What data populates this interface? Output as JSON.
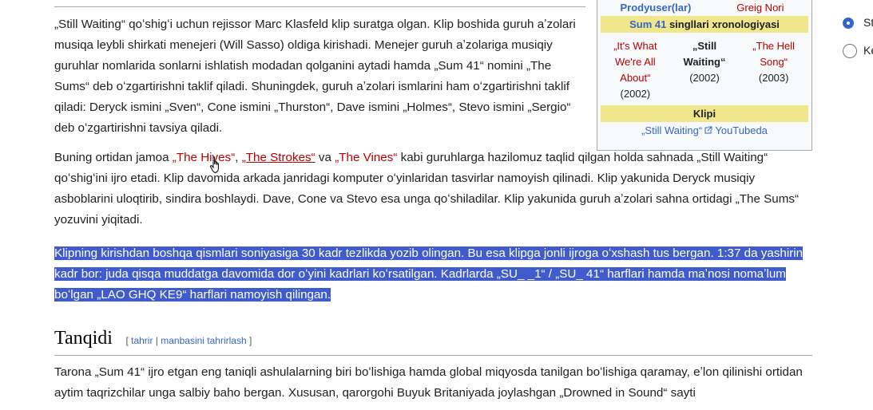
{
  "infobox": {
    "producer_label": "Prodyuser(lar)",
    "producer_value": "Greig Nori",
    "chronology_artist": "Sum 41",
    "chronology_label": " singllari xronologiyasi",
    "prev_title": "„It's What We're All About“",
    "prev_year": "(2002)",
    "current_title": "„Still Waiting“",
    "current_year": "(2002)",
    "next_title": "„The Hell Song“",
    "next_year": "(2003)",
    "video_header": "Klipi",
    "video_link": "„Still Waiting“",
    "video_site": "YouTubeda"
  },
  "para1": "„Still Waiting“ qoʻshigʻi uchun rejissor Marc Klasfeld klip suratga olgan. Klip boshida guruh aʼzolari musiqa leybli shirkati menejeri (Will Sasso) oldiga kirishadi. Menejer guruh aʼzolariga musiqiy guruhlar nomlarida sonlarni ishlatish modadan qolganini aytadi hamda „Sum 41“ nomini „The Sums“ deb oʻzgartirishni taklif qiladi. Shuningdek, guruh aʼzolari ismlarini ham oʻzgartirishni taklif qiladi: Deryck ismini „Sven“, Cone ismini „Thurston“, Dave ismini „Holmes“, Stevo ismini „Sergio“ deb oʻzgartirishni tavsiya qiladi.",
  "para2": {
    "lead": "Buning ortidan jamoa ",
    "link1": "„The Hives“",
    "sep1": ", ",
    "link2": "„The Strokes“",
    "sep2": " va ",
    "link3": "„The Vines“",
    "rest": " kabi guruhlarga hazilomuz taqlid qilgan holda sahnada „Still Waiting“ qoʻshigʻini ijro etadi. Klip davomida arkada janridagi komputer oʻyinlaridan tasvirlar namoyish qilinadi. Klip yakunida Deryck musiqiy asboblarini uloqtirib, sindira boshlaydi. Dave, Cone va Stevo esa unga qoʻshiladilar. Klip yakunida guruh aʼzolari sahna ortidagi „The Sums“ yozuvini yiqitadi."
  },
  "para3": "Klipning kirishdan boshqa qismlari soniyasiga 30 kadr tezlikda yozib olingan. Bu esa klipga jonli ijroga oʻxshash tus bergan. 1:37 da yashirin kadr bor: juda qisqa muddatga davomida dor oʻyini kadrlari koʻrsatilgan. Kadrlarda „SU_ _1“ / „SU_ 41“ harflari hamda maʼnosi nomaʼlum boʻlgan „LAO GHQ KE9“ harflari namoyish qilingan.",
  "section": {
    "title": "Tanqidi",
    "bracket_open": "[ ",
    "edit": "tahrir",
    "divider": " | ",
    "edit_source": "manbasini tahrirlash",
    "bracket_close": " ]"
  },
  "para4": "Tarona „Sum 41“ ijro etgan eng taniqli ashulalarning biri boʻlishiga hamda global miqyosda tanilgan boʻlishiga qaramay, eʼlon qilinishi ortidan aytim taqrizchilar unga salbiy baho bergan. Xususan, qarorgohi Buyuk Britaniyada joylashgan „Drowned in Sound“ sayti",
  "side_options": [
    {
      "label": "St",
      "selected": true
    },
    {
      "label": "Ke",
      "selected": false
    }
  ]
}
